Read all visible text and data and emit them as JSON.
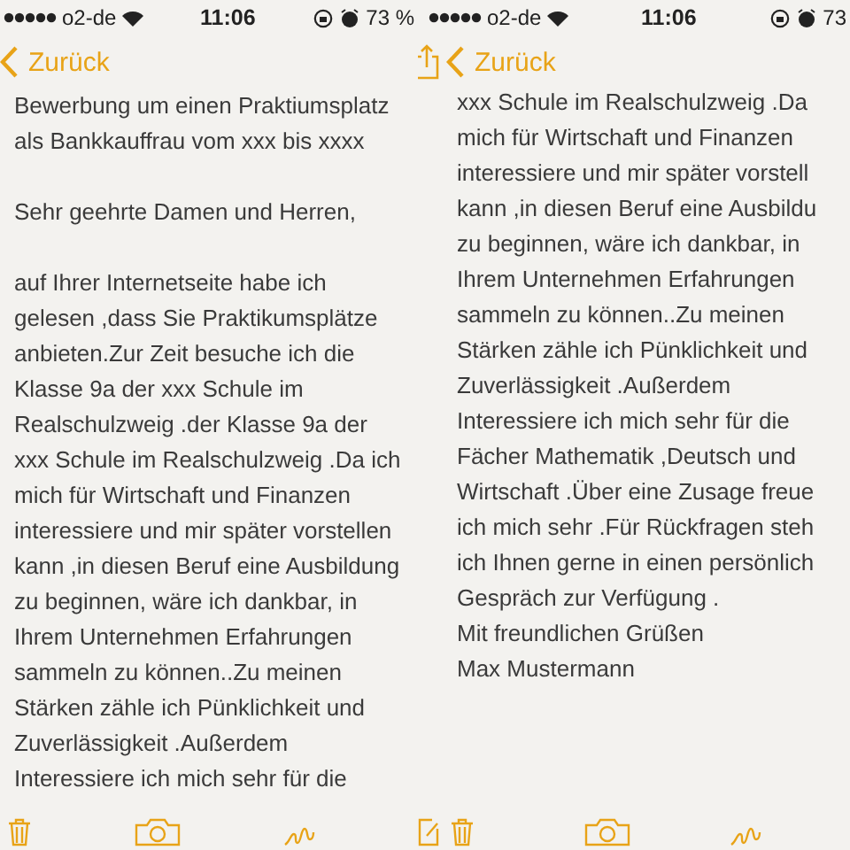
{
  "panels": [
    {
      "status_bar": {
        "carrier": "o2-de",
        "time": "11:06",
        "battery": "73 %"
      },
      "nav": {
        "back": "Zurück",
        "share": false
      },
      "paragraphs": [
        [
          "Bewerbung um einen Praktiumsplatz",
          "als Bankkauffrau vom xxx bis xxxx"
        ],
        [
          "Sehr geehrte Damen und Herren,"
        ],
        [
          "auf Ihrer Internetseite habe ich",
          "gelesen ,dass Sie Praktikumsplätze",
          "anbieten.Zur Zeit besuche ich die",
          "Klasse 9a der xxx Schule im",
          "Realschulzweig .der Klasse 9a der",
          "xxx Schule im Realschulzweig .Da ich",
          "mich für Wirtschaft und Finanzen",
          "interessiere und mir später vorstellen",
          "kann ,in diesen Beruf eine Ausbildung",
          "zu beginnen, wäre ich dankbar, in",
          "Ihrem Unternehmen Erfahrungen",
          "sammeln zu können..Zu meinen",
          "Stärken zähle ich Pünklichkeit und",
          "Zuverlässigkeit .Außerdem",
          "Interessiere ich mich sehr für die"
        ]
      ],
      "toolbar": [
        {
          "kind": "trash"
        },
        {
          "kind": "camera"
        },
        {
          "kind": "pen"
        }
      ]
    },
    {
      "status_bar": {
        "carrier": "o2-de",
        "time": "11:06",
        "battery": "73"
      },
      "nav": {
        "back": "Zurück",
        "share": true
      },
      "paragraphs": [
        [
          "xxx Schule im Realschulzweig .Da",
          "mich für Wirtschaft und Finanzen",
          "interessiere und mir später vorstell",
          "kann ,in diesen Beruf eine Ausbildu",
          "zu beginnen, wäre ich dankbar, in",
          "Ihrem Unternehmen Erfahrungen",
          "sammeln zu können..Zu meinen",
          "Stärken zähle ich Pünklichkeit und",
          "Zuverlässigkeit .Außerdem",
          "Interessiere ich mich sehr für die",
          "Fächer Mathematik ,Deutsch und",
          "Wirtschaft .Über eine Zusage freue",
          "ich mich sehr .Für Rückfragen steh",
          "ich Ihnen gerne in einen persönlich",
          "Gespräch zur Verfügung .",
          "Mit freundlichen Grüßen",
          "Max Mustermann"
        ]
      ],
      "toolbar": [
        {
          "kind": "compose"
        },
        {
          "kind": "trash"
        },
        {
          "kind": "camera"
        },
        {
          "kind": "pen"
        }
      ]
    }
  ]
}
